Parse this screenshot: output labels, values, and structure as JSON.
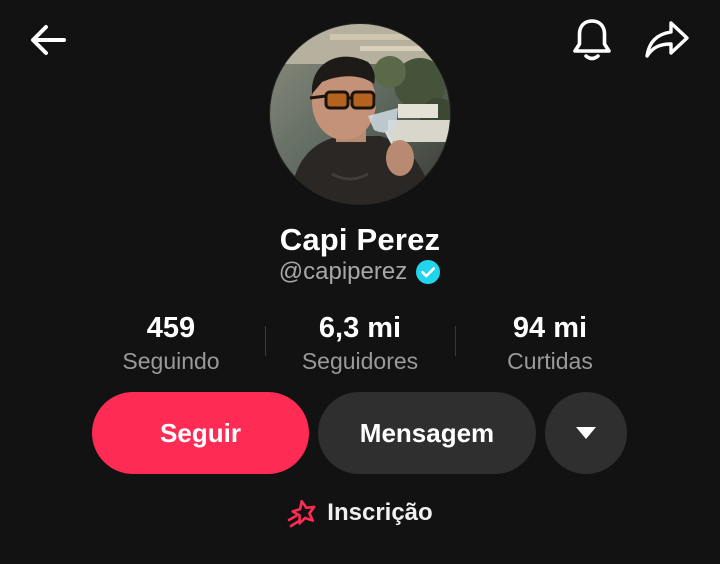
{
  "header": {
    "back_icon": "arrow-left-icon",
    "notifications_icon": "bell-icon",
    "share_icon": "share-arrow-icon"
  },
  "profile": {
    "display_name": "Capi Perez",
    "handle": "@capiperez",
    "verified_icon": "verified-check-icon",
    "verified_color": "#20d5ec"
  },
  "stats": [
    {
      "value": "459",
      "label": "Seguindo"
    },
    {
      "value": "6,3 mi",
      "label": "Seguidores"
    },
    {
      "value": "94 mi",
      "label": "Curtidas"
    }
  ],
  "actions": {
    "follow_label": "Seguir",
    "follow_color": "#fe2c55",
    "message_label": "Mensagem",
    "more_icon": "caret-down-icon"
  },
  "subscription": {
    "label": "Inscrição",
    "icon": "star-icon",
    "icon_color": "#fe2c55"
  }
}
